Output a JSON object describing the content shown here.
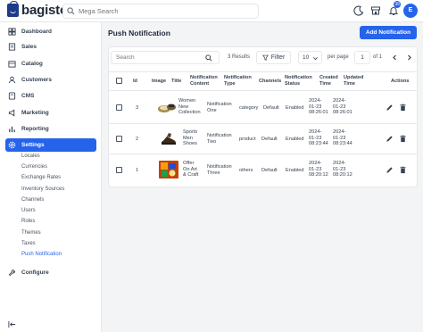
{
  "header": {
    "logo_text": "bagisto",
    "search_placeholder": "Mega Search",
    "notification_count": "39",
    "avatar_initial": "E"
  },
  "sidebar": {
    "items": [
      {
        "label": "Dashboard",
        "icon": "dashboard-icon"
      },
      {
        "label": "Sales",
        "icon": "sales-icon"
      },
      {
        "label": "Catalog",
        "icon": "catalog-icon"
      },
      {
        "label": "Customers",
        "icon": "customers-icon"
      },
      {
        "label": "CMS",
        "icon": "cms-icon"
      },
      {
        "label": "Marketing",
        "icon": "marketing-icon"
      },
      {
        "label": "Reporting",
        "icon": "reporting-icon"
      },
      {
        "label": "Settings",
        "icon": "settings-icon"
      },
      {
        "label": "Configure",
        "icon": "configure-icon"
      }
    ],
    "settings_sub": [
      "Locales",
      "Currencies",
      "Exchange Rates",
      "Inventory Sources",
      "Channels",
      "Users",
      "Roles",
      "Themes",
      "Taxes",
      "Push Notification"
    ],
    "active_sub": "Push Notification"
  },
  "page": {
    "title": "Push Notification",
    "add_button": "Add Notification"
  },
  "toolbar": {
    "search_placeholder": "Search",
    "results": "3 Results",
    "filter_label": "Filter",
    "per_page_value": "10",
    "per_page_label": "per page",
    "page_value": "1",
    "of_label": "of 1"
  },
  "table": {
    "headers": {
      "id": "Id",
      "image": "Image",
      "title": "Title",
      "content": [
        "Notification",
        "Content"
      ],
      "type": [
        "Notification",
        "Type"
      ],
      "channels": "Channels",
      "status": [
        "Notification",
        "Status"
      ],
      "created": [
        "Created",
        "Time"
      ],
      "updated": [
        "Updated",
        "Time"
      ],
      "actions": "Actions"
    },
    "rows": [
      {
        "id": "3",
        "title": [
          "Women",
          "New",
          "Collection"
        ],
        "content": [
          "Notification",
          "One"
        ],
        "type": "category",
        "channels": "Default",
        "status": "Enabled",
        "created": [
          "2024-",
          "01-23",
          "08:26:01"
        ],
        "updated": [
          "2024-",
          "01-23",
          "08:26:01"
        ]
      },
      {
        "id": "2",
        "title": [
          "Sports",
          "Men",
          "Shoes"
        ],
        "content": [
          "Notification",
          "Two"
        ],
        "type": "product",
        "channels": "Default",
        "status": "Enabled",
        "created": [
          "2024-",
          "01-23",
          "08:23:44"
        ],
        "updated": [
          "2024-",
          "01-23",
          "08:23:44"
        ]
      },
      {
        "id": "1",
        "title": [
          "Offer",
          "On Art",
          "& Craft"
        ],
        "content": [
          "Notification",
          "Three"
        ],
        "type": "others",
        "channels": "Default",
        "status": "Enabled",
        "created": [
          "2024-",
          "01-23",
          "08:20:12"
        ],
        "updated": [
          "2024-",
          "01-23",
          "08:20:12"
        ]
      }
    ]
  },
  "colors": {
    "accent": "#2563eb",
    "text": "#374151",
    "border": "#e5e7eb"
  }
}
